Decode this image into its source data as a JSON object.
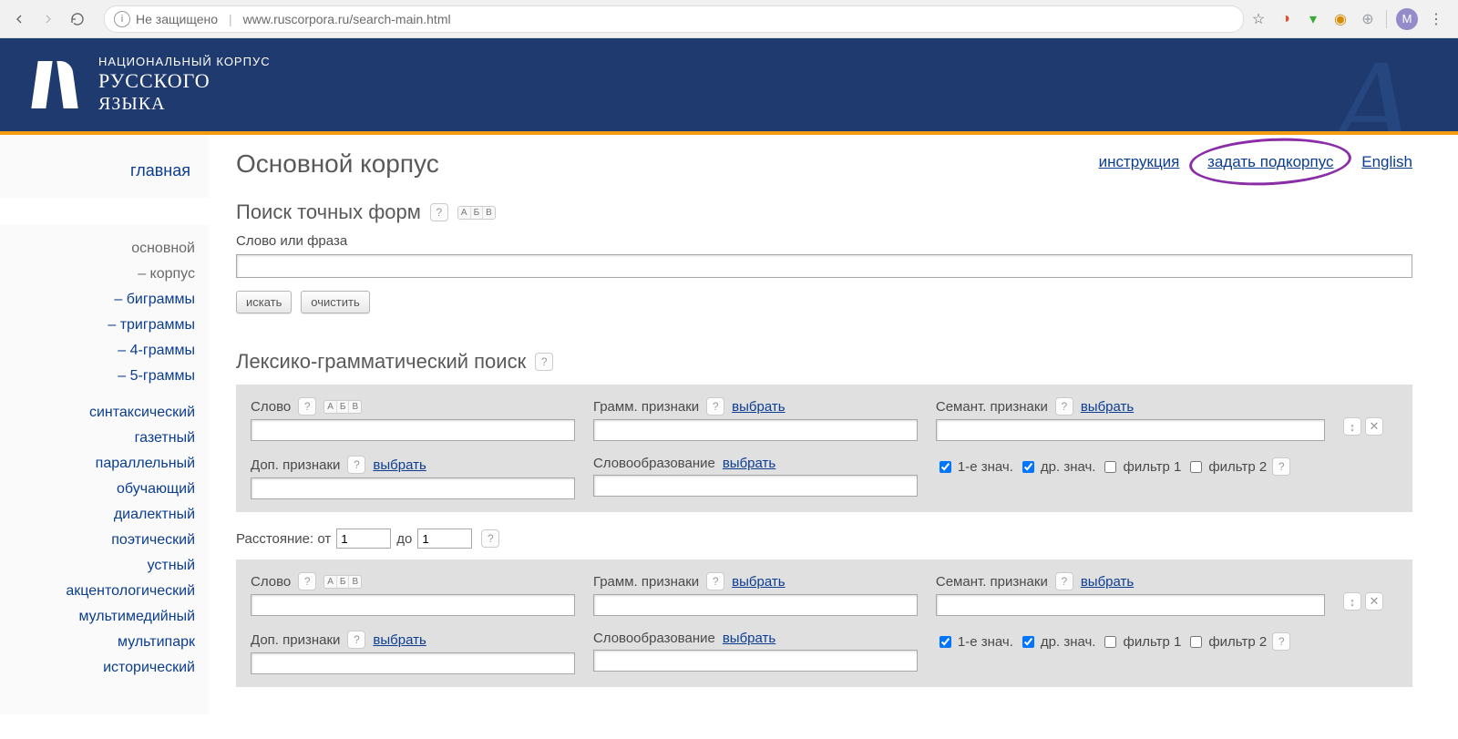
{
  "chrome": {
    "security_label": "Не защищено",
    "url": "www.ruscorpora.ru/search-main.html",
    "avatar_letter": "М"
  },
  "header": {
    "line1": "НАЦИОНАЛЬНЫЙ КОРПУС",
    "line2": "РУССКОГО",
    "line3": "ЯЗЫКА"
  },
  "sidebar": {
    "primary": "главная",
    "main_item": "основной",
    "subitems": [
      {
        "label": "– корпус",
        "inactive": true
      },
      {
        "label": "– биграммы",
        "inactive": false
      },
      {
        "label": "– триграммы",
        "inactive": false
      },
      {
        "label": "– 4-граммы",
        "inactive": false
      },
      {
        "label": "– 5-граммы",
        "inactive": false
      }
    ],
    "others": [
      "синтаксический",
      "газетный",
      "параллельный",
      "обучающий",
      "диалектный",
      "поэтический",
      "устный",
      "акцентологический",
      "мультимедийный",
      "мультипарк",
      "исторический"
    ]
  },
  "main": {
    "page_title": "Основной корпус",
    "toplinks": {
      "instruction": "инструкция",
      "set_subcorpus": "задать подкорпус",
      "english": "English"
    },
    "exact": {
      "title": "Поиск точных форм",
      "word_label": "Слово или фраза",
      "search_btn": "искать",
      "clear_btn": "очистить"
    },
    "lex": {
      "title": "Лексико-грамматический поиск",
      "word_label": "Слово",
      "gram_label": "Грамм. признаки",
      "sem_label": "Семант. признаки",
      "select_link": "выбрать",
      "add_label": "Доп. признаки",
      "morph_label": "Словообразование",
      "meaning1": "1-е знач.",
      "meaning_other": "др. знач.",
      "filter1": "фильтр 1",
      "filter2": "фильтр 2",
      "distance_label": "Расстояние: от",
      "distance_to": "до",
      "distance_from_val": "1",
      "distance_to_val": "1"
    },
    "abc": {
      "a": "А",
      "b": "Б",
      "v": "В"
    }
  }
}
